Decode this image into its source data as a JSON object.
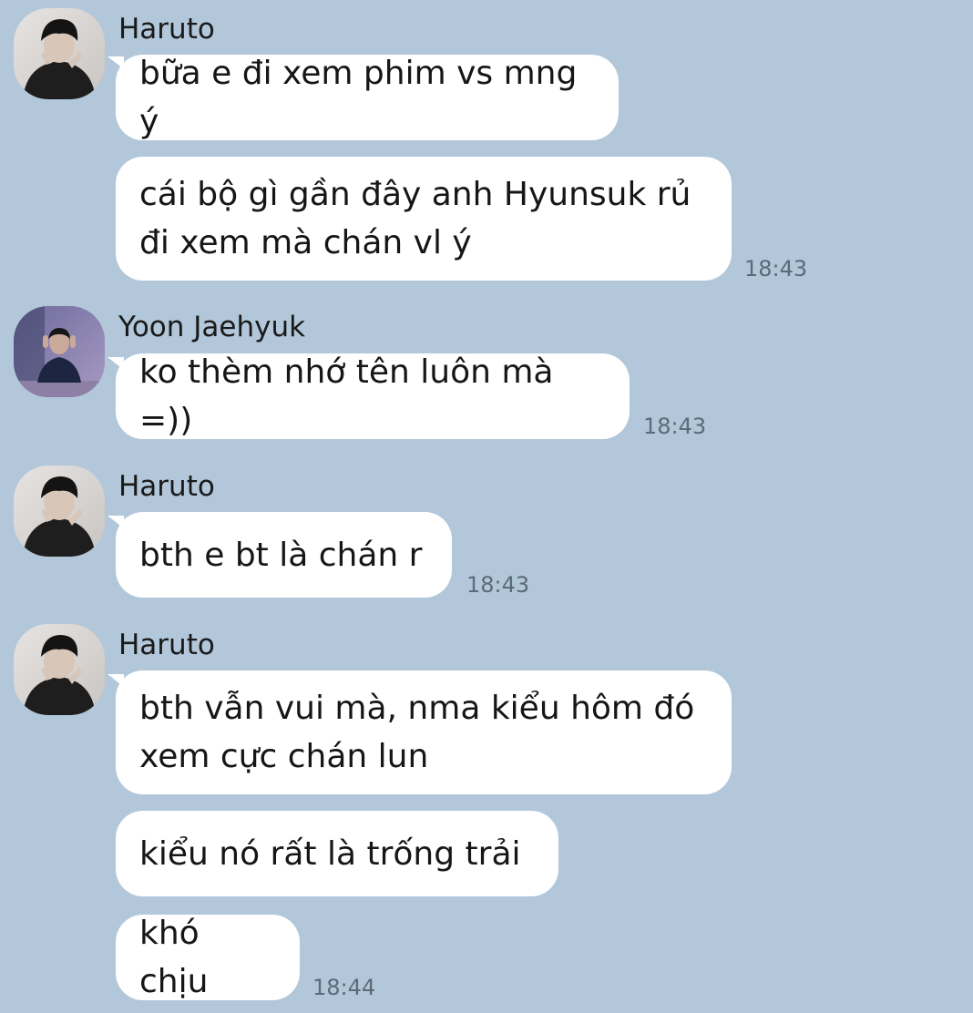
{
  "chat": {
    "groups": [
      {
        "sender": "Haruto",
        "avatar_icon": "haruto-avatar",
        "messages": [
          {
            "text": "bữa e đi xem phim vs mng ý",
            "time": ""
          },
          {
            "text": "cái bộ gì gần đây anh Hyunsuk rủ\nđi xem mà chán vl ý",
            "time": "18:43"
          }
        ]
      },
      {
        "sender": "Yoon Jaehyuk",
        "avatar_icon": "yoon-jaehyuk-avatar",
        "messages": [
          {
            "text": "ko thèm nhớ tên luôn mà =))",
            "time": "18:43"
          }
        ]
      },
      {
        "sender": "Haruto",
        "avatar_icon": "haruto-avatar",
        "messages": [
          {
            "text": "bth e bt là chán r",
            "time": "18:43"
          }
        ]
      },
      {
        "sender": "Haruto",
        "avatar_icon": "haruto-avatar",
        "messages": [
          {
            "text": "bth vẫn vui mà, nma kiểu hôm đó\nxem cực chán lun",
            "time": ""
          },
          {
            "text": "kiểu nó rất là trống trải",
            "time": ""
          },
          {
            "text": "khó chịu",
            "time": "18:44"
          }
        ]
      }
    ]
  },
  "colors": {
    "background": "#b2c7da",
    "bubble": "#ffffff",
    "timestamp": "#5d6a78"
  }
}
